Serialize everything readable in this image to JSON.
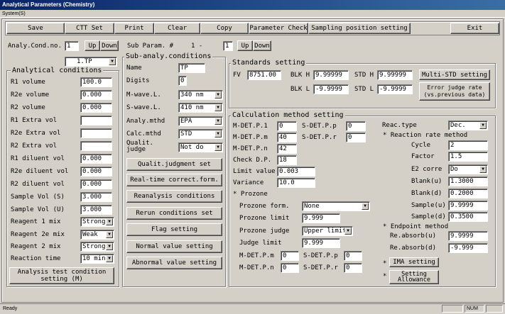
{
  "window": {
    "title": "Analytical Parameters (Chemistry)",
    "menu": "System(S)",
    "status": "Ready",
    "num": "NUM"
  },
  "toolbar": [
    "Save",
    "CTT Set",
    "Print",
    "Clear",
    "Copy",
    "Parameter Check",
    "Sampling position setting",
    "Exit"
  ],
  "cond": {
    "label": "Analy.Cond.no.",
    "value": "1",
    "up": "Up",
    "down": "Down",
    "test": "1.TP",
    "sub_label": "Sub Param. #",
    "sub_sep": "1 -",
    "sub_value": "1"
  },
  "analytical": {
    "title": "Analytical conditions",
    "rows": [
      {
        "label": "R1 volume",
        "value": "100.0"
      },
      {
        "label": "R2e volume",
        "value": "0.000"
      },
      {
        "label": "R2 volume",
        "value": "0.000"
      },
      {
        "label": "R1 Extra vol",
        "value": ""
      },
      {
        "label": "R2e Extra vol",
        "value": ""
      },
      {
        "label": "R2 Extra vol",
        "value": ""
      },
      {
        "label": "R1 diluent vol",
        "value": "0.000"
      },
      {
        "label": "R2e diluent vol",
        "value": "0.000"
      },
      {
        "label": "R2 diluent vol",
        "value": "0.000"
      },
      {
        "label": "Sample Vol (S)",
        "value": "3.000"
      },
      {
        "label": "Sample Vol (U)",
        "value": "3.000"
      }
    ],
    "selects": [
      {
        "label": "Reagent 1 mix",
        "value": "Strong"
      },
      {
        "label": "Reagent 2e mix",
        "value": "Weak"
      },
      {
        "label": "Reagent 2 mix",
        "value": "Strong"
      },
      {
        "label": "Reaction time",
        "value": "10 min."
      }
    ],
    "button": "Analysis test condition setting (M)"
  },
  "sub": {
    "title": "Sub-analy.conditions",
    "name_label": "Name",
    "name": "TP",
    "digits_label": "Digits",
    "digits": "0",
    "selects": [
      {
        "label": "M-wave.L.",
        "value": "340 nm"
      },
      {
        "label": "S-wave.L.",
        "value": "410 nm"
      },
      {
        "label": "Analy.mthd",
        "value": "EPA"
      },
      {
        "label": "Calc.mthd",
        "value": "STD"
      },
      {
        "label": "Qualit. judge",
        "value": "Not do"
      }
    ],
    "buttons": [
      "Qualit.judgment set",
      "Real-time correct.form.",
      "Reanalysis conditions",
      "Rerun conditions set",
      "Flag setting",
      "Normal value setting",
      "Abnormal value setting"
    ]
  },
  "standards": {
    "title": "Standards setting",
    "fv_label": "FV",
    "fv": "8751.00",
    "blkh_label": "BLK H",
    "blkh": "9.99999",
    "stdh_label": "STD H",
    "stdh": "9.99999",
    "multi": "Multi-STD setting",
    "blkl_label": "BLK L",
    "blkl": "-9.9999",
    "stdl_label": "STD L",
    "stdl": "-9.9999",
    "err": "Error judge rate (vs.previous data)"
  },
  "calc": {
    "title": "Calculation method setting",
    "mdet": [
      {
        "label": "M-DET.P.1",
        "value": "0"
      },
      {
        "label": "M-DET.P.m",
        "value": "40"
      },
      {
        "label": "M-DET.P.n",
        "value": "42"
      }
    ],
    "sdet": [
      {
        "label": "S-DET.P.p",
        "value": "0"
      },
      {
        "label": "S-DET.P.r",
        "value": "0"
      }
    ],
    "check_label": "Check D.P.",
    "check": "18",
    "limit_label": "Limit value",
    "limit": "0.003",
    "variance_label": "Variance",
    "variance": "10.0",
    "prozone": "* Prozone",
    "pform_label": "Prozone form.",
    "pform": "None",
    "plimit_label": "Prozone limit",
    "plimit": "9.999",
    "pjudge_label": "Prozone judge",
    "pjudge": "Upper limit",
    "jlimit_label": "Judge limit",
    "jlimit": "9.999",
    "pm_label": "M-DET.P.m",
    "pm": "0",
    "pp_label": "S-DET.P.p",
    "pp": "0",
    "pn_label": "M-DET.P.n",
    "pn": "0",
    "pr_label": "S-DET.P.r",
    "pr": "0",
    "reac_label": "Reac.type",
    "reac": "Dec.",
    "rr": "* Reaction rate method",
    "rrows": [
      {
        "label": "Cycle",
        "value": "2"
      },
      {
        "label": "Factor",
        "value": "1.5"
      }
    ],
    "e2_label": "E2 corre",
    "e2": "Do",
    "rrows2": [
      {
        "label": "Blank(u)",
        "value": "1.3000"
      },
      {
        "label": "Blank(d)",
        "value": "0.2000"
      },
      {
        "label": "Sample(u)",
        "value": "9.9999"
      },
      {
        "label": "Sample(d)",
        "value": "0.3500"
      }
    ],
    "ep": "* Endpoint method",
    "eprows": [
      {
        "label": "Re.absorb(u)",
        "value": "9.9999"
      },
      {
        "label": "Re.absorb(d)",
        "value": "-9.999"
      }
    ],
    "ima_star": "*",
    "ima": "IMA setting",
    "allow_star": "*",
    "allow": "Setting Allowance"
  }
}
